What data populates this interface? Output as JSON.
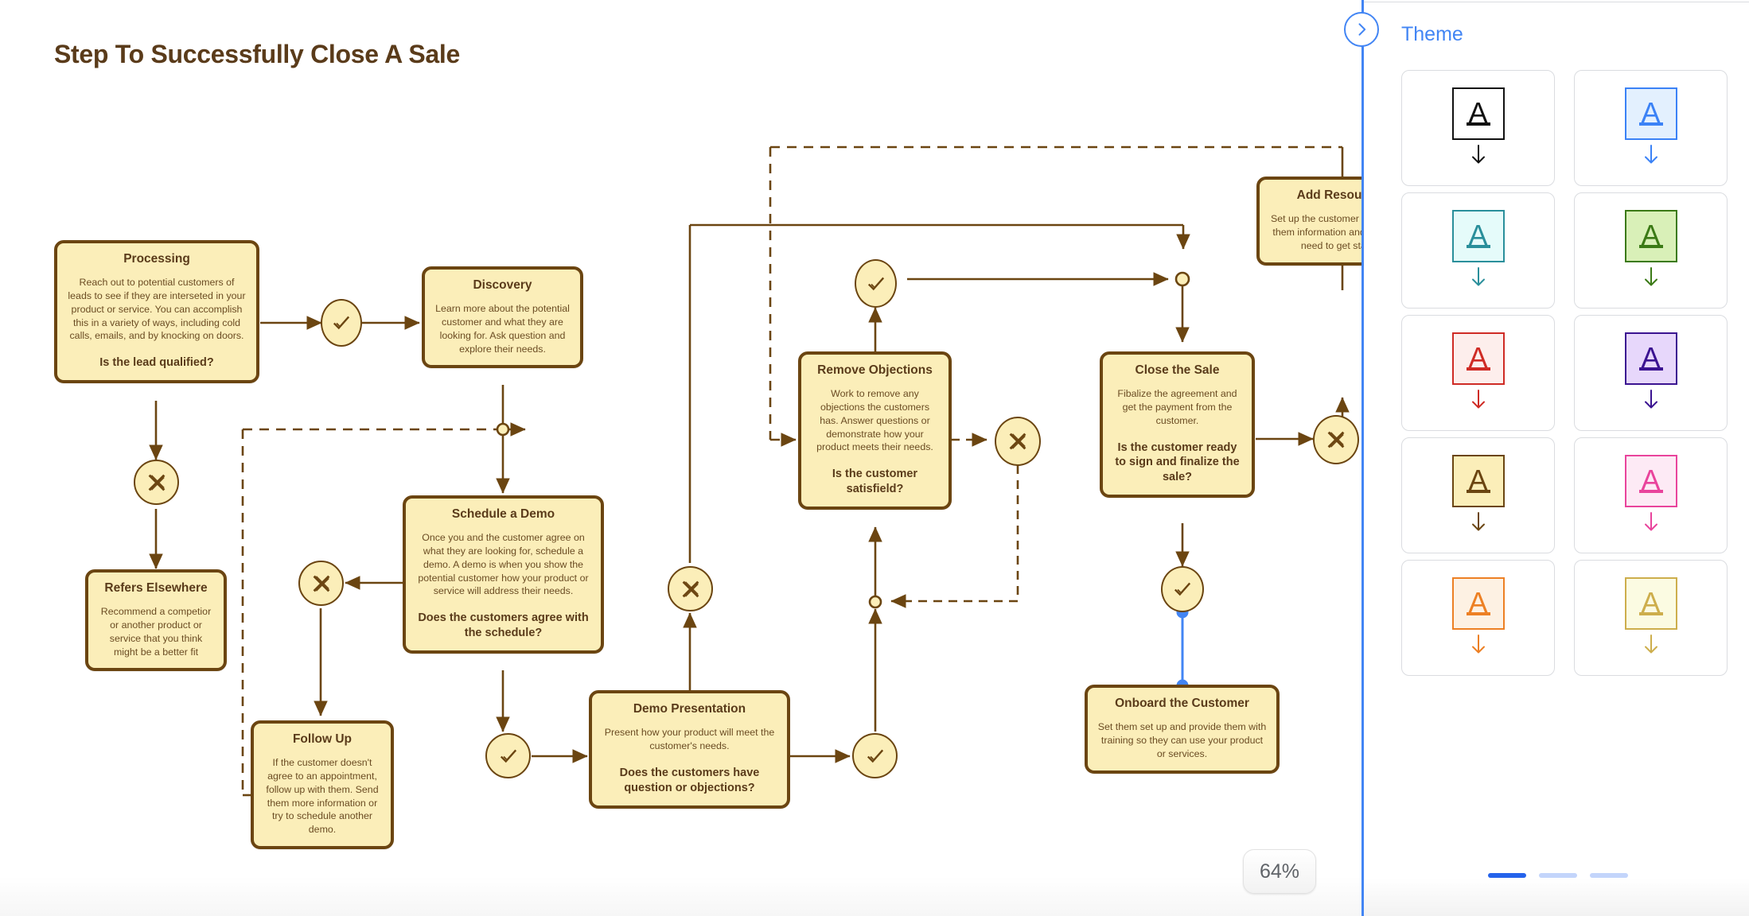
{
  "canvas": {
    "title": "Step To Successfully Close A Sale",
    "zoom_label": "64%"
  },
  "nodes": [
    {
      "id": "processing",
      "title": "Processing",
      "body": "Reach out to potential customers of leads to see if they are interseted in your product or service. You can accomplish this in a variety of ways, including cold calls, emails, and by knocking on doors.",
      "question": "Is the lead qualified?"
    },
    {
      "id": "discovery",
      "title": "Discovery",
      "body": "Learn more about the potential customer and what they are looking for. Ask question and explore their needs.",
      "question": ""
    },
    {
      "id": "refers-elsewhere",
      "title": "Refers Elsewhere",
      "body": "Recommend a competior or another product or service that you think might be a better fit",
      "question": ""
    },
    {
      "id": "schedule-a-demo",
      "title": "Schedule a Demo",
      "body": "Once you and the customer agree on what they are looking for, schedule a demo. A demo is when you show the potential customer how your product or service will address their needs.",
      "question": "Does the customers agree with the schedule?"
    },
    {
      "id": "follow-up",
      "title": "Follow Up",
      "body": "If the customer doesn't agree to an appointment, follow up with them. Send them more information or try to schedule another demo.",
      "question": ""
    },
    {
      "id": "demo-presentation",
      "title": "Demo Presentation",
      "body": "Present how your product will meet the customer's needs.",
      "question": "Does the customers have question or objections?"
    },
    {
      "id": "remove-objections",
      "title": "Remove Objections",
      "body": "Work to remove any objections the customers has. Answer questions or demonstrate how your product meets their needs.",
      "question": "Is the customer satisfield?"
    },
    {
      "id": "close-the-sale",
      "title": "Close the Sale",
      "body": "Fibalize the agreement and get the payment from the customer.",
      "question": "Is the customer ready to sign and finalize the sale?"
    },
    {
      "id": "onboard-the-customer",
      "title": "Onboard the Customer",
      "body": "Set them set up and provide them with training so they can use your product or services.",
      "question": ""
    },
    {
      "id": "add-resources",
      "title": "Add Resources",
      "body": "Set up the customer and provide them information and resources need to get started",
      "question": ""
    }
  ],
  "panel": {
    "title": "Theme",
    "toggle_icon": "chevron-right-icon",
    "themes": [
      {
        "name": "black",
        "fill": "#ffffff",
        "stroke": "#111111",
        "ink": "#111111"
      },
      {
        "name": "blue",
        "fill": "#e3f0fe",
        "stroke": "#3b82f6",
        "ink": "#3b82f6"
      },
      {
        "name": "teal",
        "fill": "#e5fbfa",
        "stroke": "#2a8f9b",
        "ink": "#2a8f9b"
      },
      {
        "name": "green",
        "fill": "#d9f0b8",
        "stroke": "#3b7a16",
        "ink": "#3b7a16"
      },
      {
        "name": "red",
        "fill": "#fdeeec",
        "stroke": "#cf2b25",
        "ink": "#cf2b25"
      },
      {
        "name": "purple",
        "fill": "#e7d7fb",
        "stroke": "#3b1391",
        "ink": "#3b1391"
      },
      {
        "name": "amber",
        "fill": "#fbeeb9",
        "stroke": "#6b4511",
        "ink": "#6b4511"
      },
      {
        "name": "pink",
        "fill": "#fdeaf5",
        "stroke": "#e9449c",
        "ink": "#e9449c"
      },
      {
        "name": "orange",
        "fill": "#fdf1e3",
        "stroke": "#ed8024",
        "ink": "#ed8024"
      },
      {
        "name": "yellow",
        "fill": "#fbfbe2",
        "stroke": "#cdae4c",
        "ink": "#cdae4c"
      }
    ],
    "theme_letter": "A",
    "pages": [
      {
        "active": true
      },
      {
        "active": false
      },
      {
        "active": false
      }
    ]
  }
}
